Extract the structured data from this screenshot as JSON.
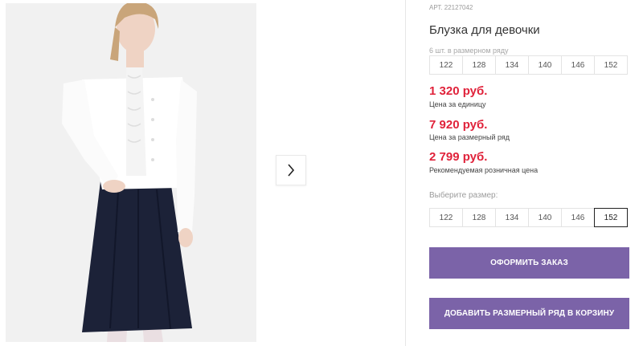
{
  "product": {
    "article_label": "АРТ.",
    "article_value": "22127042",
    "title": "Блузка для девочки"
  },
  "size_pack": {
    "caption": "6 шт. в размерном ряду",
    "sizes": [
      "122",
      "128",
      "134",
      "140",
      "146",
      "152"
    ]
  },
  "prices": [
    {
      "value": "1 320 руб.",
      "label": "Цена за единицу"
    },
    {
      "value": "7 920 руб.",
      "label": "Цена за размерный ряд"
    },
    {
      "value": "2 799 руб.",
      "label": "Рекомендуемая розничная цена"
    }
  ],
  "size_select": {
    "caption": "Выберите размер:",
    "sizes": [
      "122",
      "128",
      "134",
      "140",
      "146",
      "152"
    ],
    "selected": "152"
  },
  "actions": {
    "order_label": "ОФОРМИТЬ ЗАКАЗ",
    "cart_label": "ДОБАВИТЬ РАЗМЕРНЫЙ РЯД В КОРЗИНУ"
  },
  "gallery": {
    "next_icon": "chevron-right-icon"
  },
  "colors": {
    "price": "#e0223a",
    "button": "#7b63a8"
  }
}
